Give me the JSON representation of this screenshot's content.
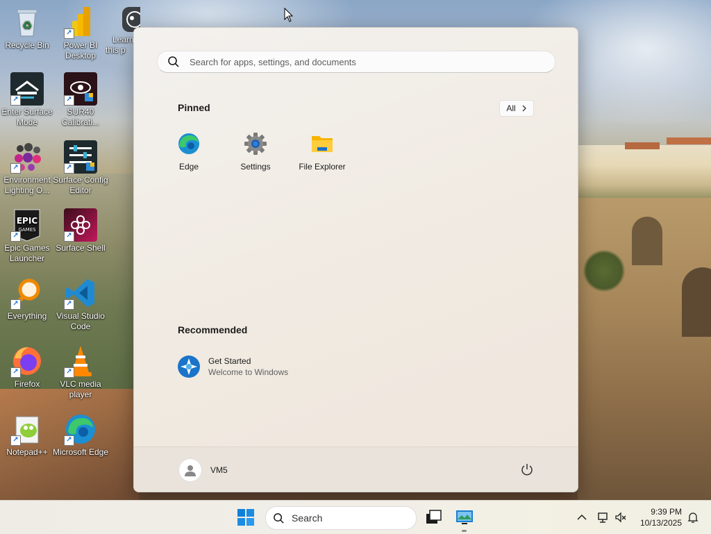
{
  "desktop": {
    "icons": [
      {
        "label": "Recycle Bin",
        "icon": "recycle-bin-icon"
      },
      {
        "label": "Power BI Desktop",
        "icon": "power-bi-icon"
      },
      {
        "label": "Learn this p",
        "icon": "learn-icon"
      },
      {
        "label": "Enter Surface Mode",
        "icon": "surface-mode-icon"
      },
      {
        "label": "SUR40 Calibrati...",
        "icon": "calibration-icon"
      },
      {
        "label": "Environment Lighting O...",
        "icon": "lighting-icon"
      },
      {
        "label": "Surface Config Editor",
        "icon": "config-editor-icon"
      },
      {
        "label": "Epic Games Launcher",
        "icon": "epic-games-icon"
      },
      {
        "label": "Surface Shell",
        "icon": "surface-shell-icon"
      },
      {
        "label": "Everything",
        "icon": "everything-search-icon"
      },
      {
        "label": "Visual Studio Code",
        "icon": "vscode-icon"
      },
      {
        "label": "Firefox",
        "icon": "firefox-icon"
      },
      {
        "label": "VLC media player",
        "icon": "vlc-icon"
      },
      {
        "label": "Notepad++",
        "icon": "notepadpp-icon"
      },
      {
        "label": "Microsoft Edge",
        "icon": "edge-icon"
      }
    ]
  },
  "start_menu": {
    "search_placeholder": "Search for apps, settings, and documents",
    "pinned_title": "Pinned",
    "all_label": "All",
    "pinned_apps": [
      {
        "label": "Edge",
        "icon": "edge-icon"
      },
      {
        "label": "Settings",
        "icon": "gear-icon"
      },
      {
        "label": "File Explorer",
        "icon": "folder-icon"
      }
    ],
    "recommended_title": "Recommended",
    "recommended": [
      {
        "title": "Get Started",
        "subtitle": "Welcome to Windows",
        "icon": "get-started-icon"
      }
    ],
    "user_name": "VM5"
  },
  "taskbar": {
    "search_label": "Search",
    "time": "9:39 PM",
    "date": "10/13/2025"
  },
  "colors": {
    "accent": "#0067c0",
    "start_menu_bg": "#f1ebe3",
    "taskbar_bg": "#efece6"
  }
}
